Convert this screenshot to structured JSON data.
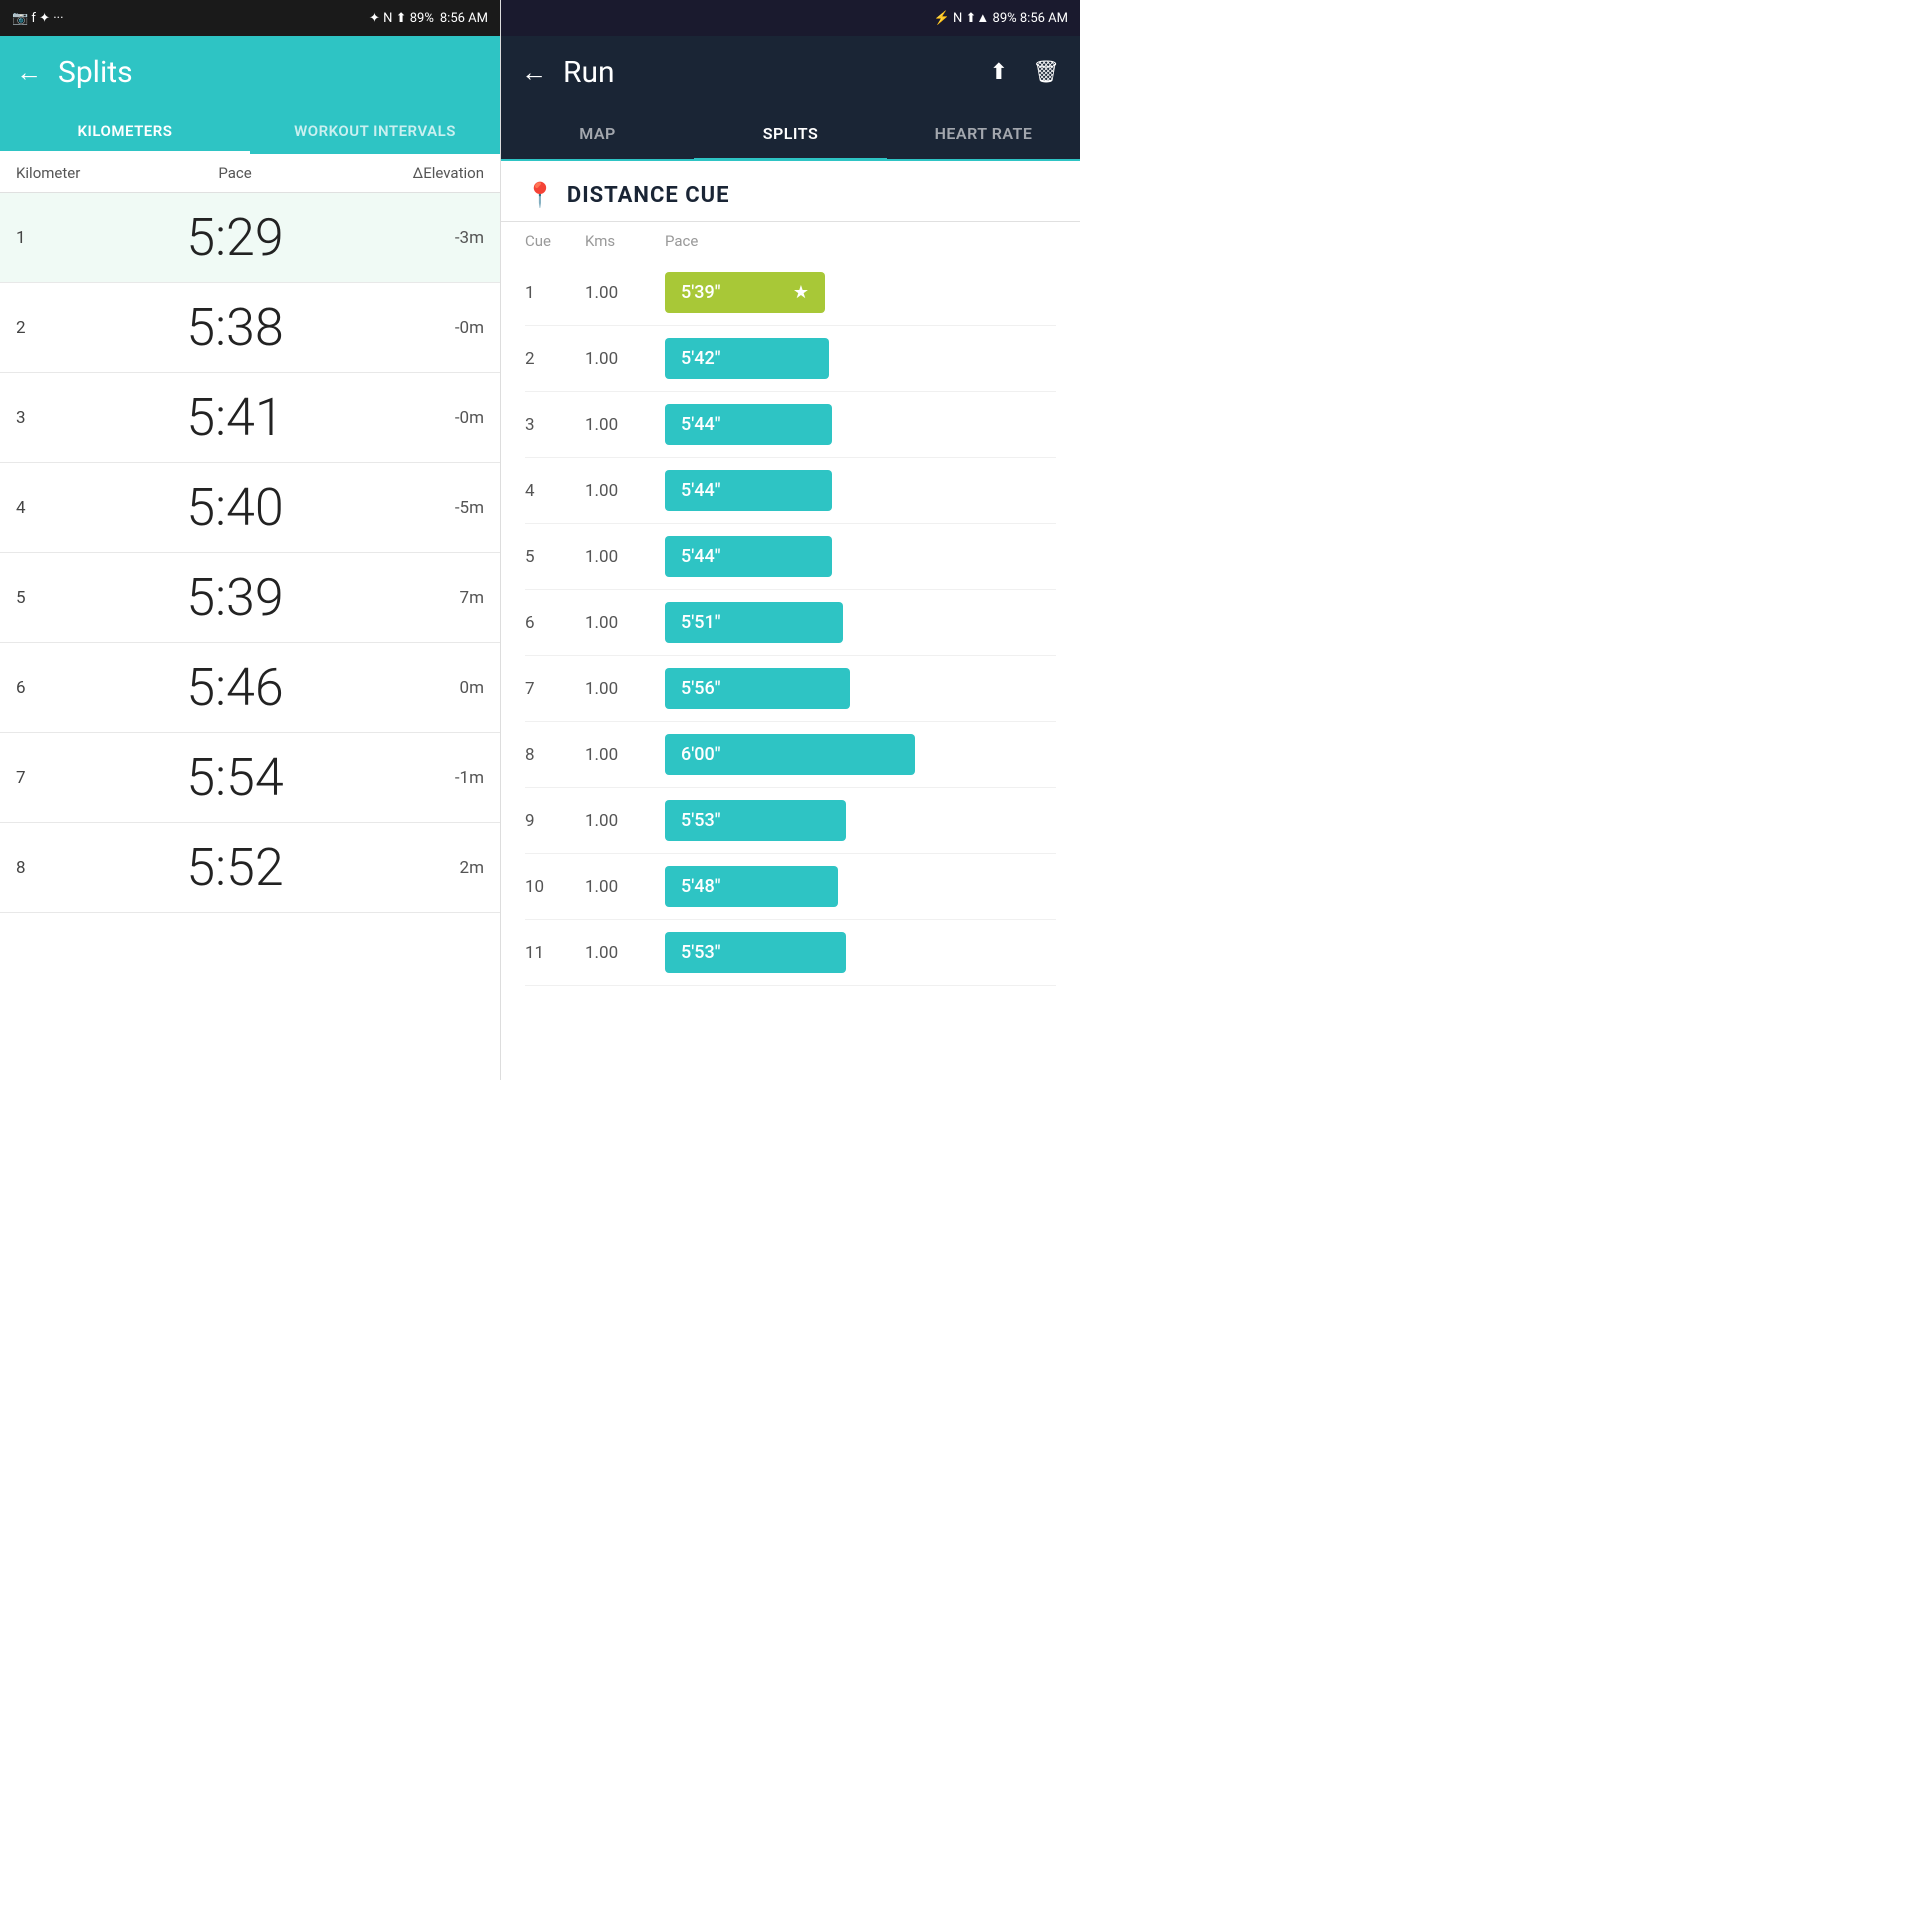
{
  "left": {
    "statusBar": {
      "left": "📷 f ✦ ···",
      "icons": "✦ N ⬆ 89%",
      "time": "8:56 AM"
    },
    "header": {
      "backLabel": "←",
      "title": "Splits"
    },
    "tabs": [
      {
        "id": "kilometers",
        "label": "KILOMETERS",
        "active": true
      },
      {
        "id": "workout-intervals",
        "label": "WORKOUT INTERVALS",
        "active": false
      }
    ],
    "columnHeaders": {
      "km": "Kilometer",
      "pace": "Pace",
      "elev": "ΔElevation"
    },
    "splits": [
      {
        "km": "1",
        "pace": "5:29",
        "elev": "-3m",
        "highlighted": true
      },
      {
        "km": "2",
        "pace": "5:38",
        "elev": "-0m",
        "highlighted": false
      },
      {
        "km": "3",
        "pace": "5:41",
        "elev": "-0m",
        "highlighted": false
      },
      {
        "km": "4",
        "pace": "5:40",
        "elev": "-5m",
        "highlighted": false
      },
      {
        "km": "5",
        "pace": "5:39",
        "elev": "7m",
        "highlighted": false
      },
      {
        "km": "6",
        "pace": "5:46",
        "elev": "0m",
        "highlighted": false
      },
      {
        "km": "7",
        "pace": "5:54",
        "elev": "-1m",
        "highlighted": false
      },
      {
        "km": "8",
        "pace": "5:52",
        "elev": "2m",
        "highlighted": false
      }
    ]
  },
  "right": {
    "statusBar": {
      "text": "⚡ N ⬆▲ 89% 8:56 AM"
    },
    "header": {
      "backLabel": "←",
      "title": "Run",
      "shareLabel": "⬆",
      "deleteLabel": "🗑"
    },
    "tabs": [
      {
        "id": "map",
        "label": "MAP",
        "active": false
      },
      {
        "id": "splits",
        "label": "SPLITS",
        "active": true
      },
      {
        "id": "heart-rate",
        "label": "HEART RATE",
        "active": false
      }
    ],
    "distanceCue": {
      "icon": "📍",
      "title": "DISTANCE CUE"
    },
    "columnHeaders": {
      "cue": "Cue",
      "kms": "Kms",
      "pace": "Pace"
    },
    "cues": [
      {
        "num": "1",
        "kms": "1.00",
        "pace": "5'39\"",
        "best": true
      },
      {
        "num": "2",
        "kms": "1.00",
        "pace": "5'42\"",
        "best": false
      },
      {
        "num": "3",
        "kms": "1.00",
        "pace": "5'44\"",
        "best": false
      },
      {
        "num": "4",
        "kms": "1.00",
        "pace": "5'44\"",
        "best": false
      },
      {
        "num": "5",
        "kms": "1.00",
        "pace": "5'44\"",
        "best": false
      },
      {
        "num": "6",
        "kms": "1.00",
        "pace": "5'51\"",
        "best": false
      },
      {
        "num": "7",
        "kms": "1.00",
        "pace": "5'56\"",
        "best": false
      },
      {
        "num": "8",
        "kms": "1.00",
        "pace": "6'00\"",
        "best": false
      },
      {
        "num": "9",
        "kms": "1.00",
        "pace": "5'53\"",
        "best": false
      },
      {
        "num": "10",
        "kms": "1.00",
        "pace": "5'48\"",
        "best": false
      },
      {
        "num": "11",
        "kms": "1.00",
        "pace": "5'53\"",
        "best": false
      }
    ],
    "colors": {
      "bestBar": "#a8c837",
      "normalBar": "#2ec4c4",
      "headerBg": "#1a2535"
    }
  }
}
